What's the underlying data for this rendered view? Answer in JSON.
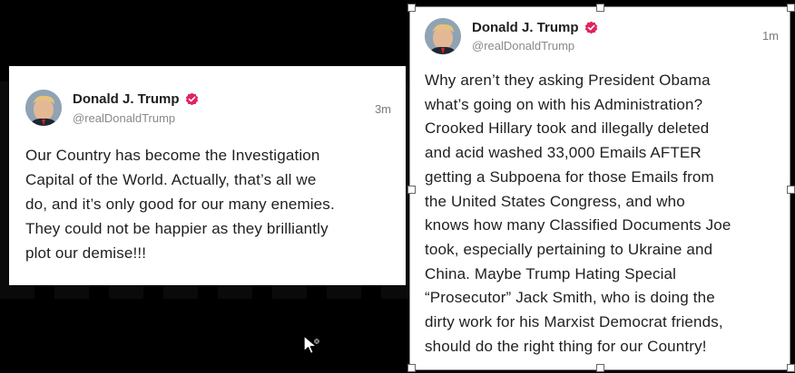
{
  "left_post": {
    "author_name": "Donald J. Trump",
    "handle": "@realDonaldTrump",
    "time": "3m",
    "lines": [
      "Our Country has become the Investigation",
      "Capital of the World. Actually, that’s all we",
      "do, and it’s only good for our many enemies.",
      "They could not be happier as they brilliantly",
      "plot our demise!!!"
    ]
  },
  "right_post": {
    "author_name": "Donald J. Trump",
    "handle": "@realDonaldTrump",
    "time": "1m",
    "lines": [
      "Why aren’t they asking President Obama",
      "what’s going on with his Administration?",
      "Crooked Hillary took and illegally deleted",
      "and acid washed 33,000 Emails AFTER",
      "getting a Subpoena for those Emails from",
      "the United States Congress, and who",
      "knows how many Classified Documents Joe",
      "took, especially pertaining to Ukraine and",
      "China. Maybe Trump Hating Special",
      "“Prosecutor” Jack Smith, who is doing the",
      "dirty work for his Marxist Democrat friends,",
      "should do the right thing for our Country!"
    ]
  },
  "colors": {
    "background": "#000000",
    "card": "#ffffff",
    "verified_badge": "#e0245e",
    "handle_text": "#8a8a8a"
  },
  "icons": {
    "verified": "verified-badge-icon",
    "cursor": "move-cursor-icon"
  }
}
